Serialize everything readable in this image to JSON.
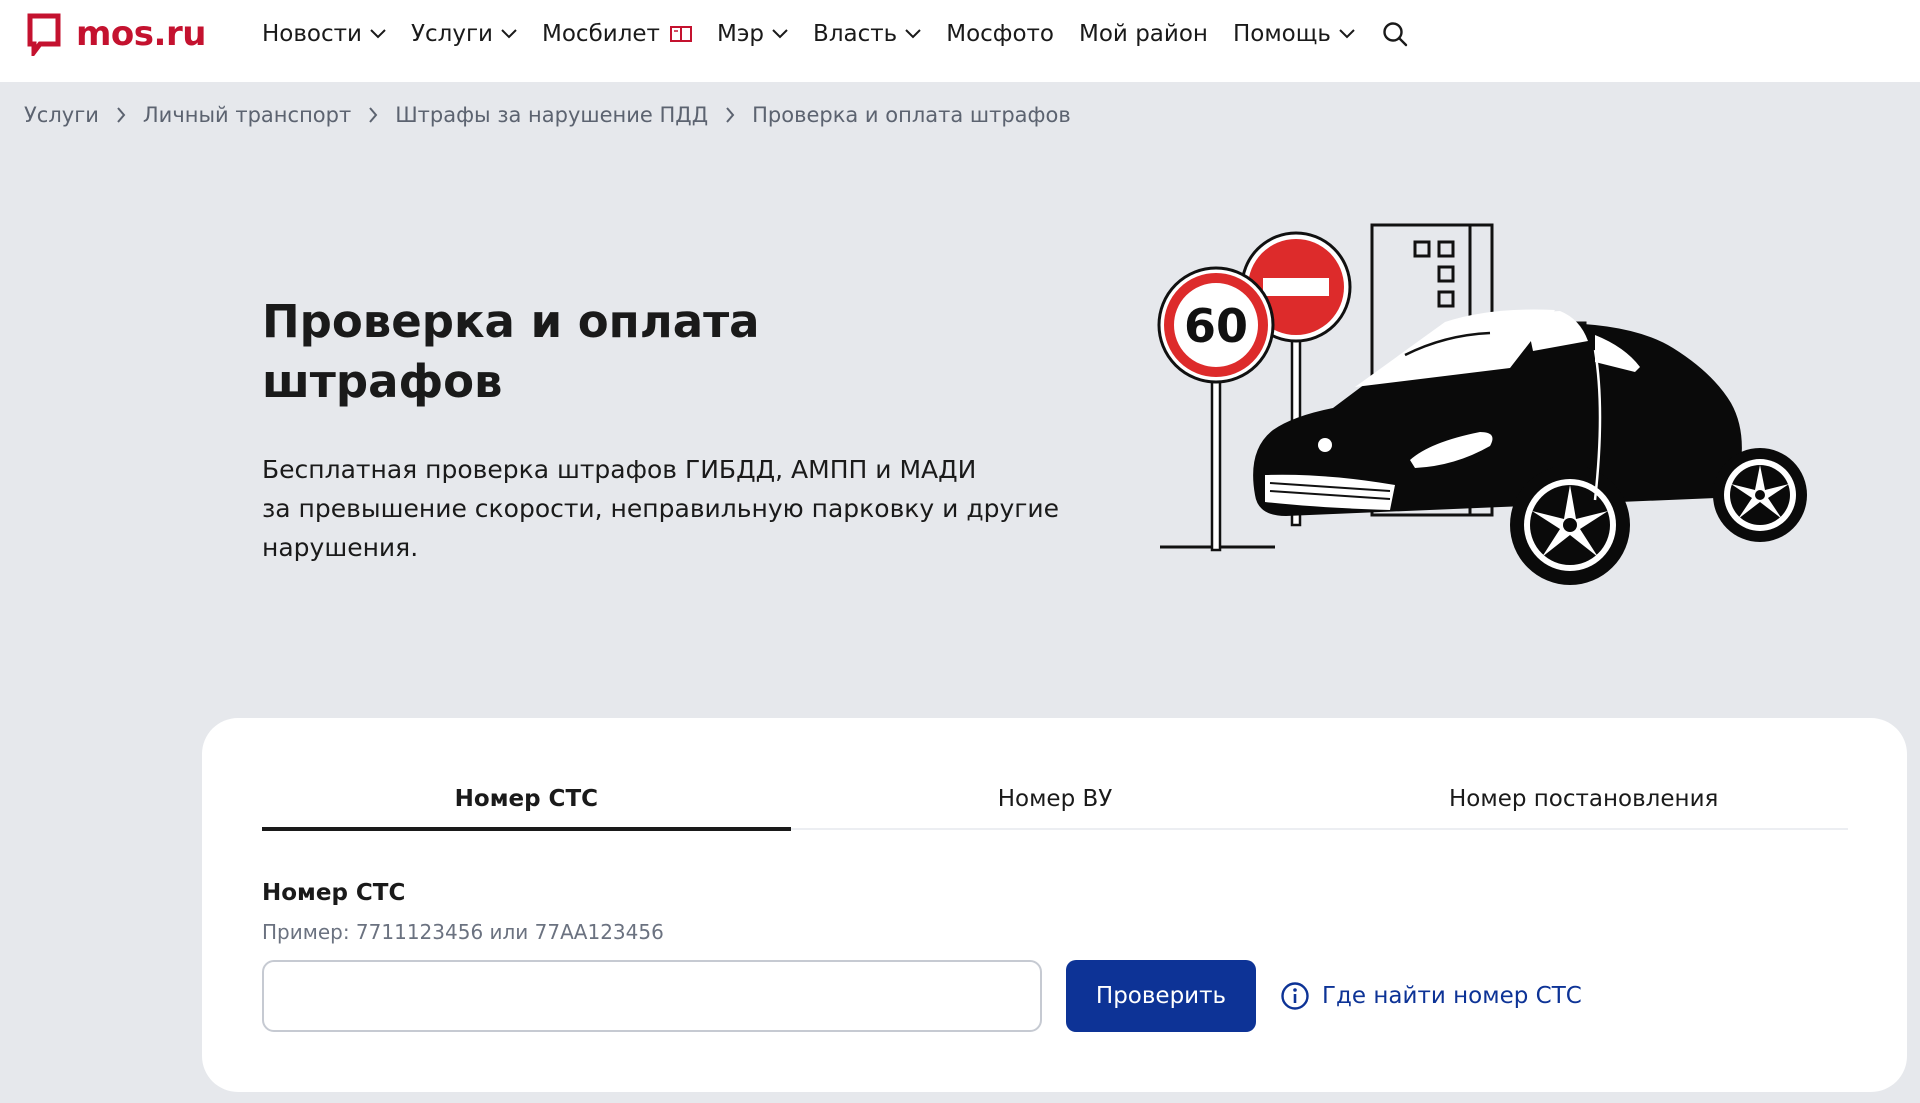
{
  "header": {
    "logo_text": "mos.ru",
    "nav": [
      {
        "label": "Новости",
        "has_dropdown": true
      },
      {
        "label": "Услуги",
        "has_dropdown": true
      },
      {
        "label": "Мосбилет",
        "has_dropdown": false,
        "icon": "ticket-icon"
      },
      {
        "label": "Мэр",
        "has_dropdown": true
      },
      {
        "label": "Власть",
        "has_dropdown": true
      },
      {
        "label": "Мосфото",
        "has_dropdown": false
      },
      {
        "label": "Мой район",
        "has_dropdown": false
      },
      {
        "label": "Помощь",
        "has_dropdown": true
      }
    ],
    "search_icon": "search-icon"
  },
  "breadcrumb": [
    "Услуги",
    "Личный транспорт",
    "Штрафы за нарушение ПДД",
    "Проверка и оплата штрафов"
  ],
  "hero": {
    "title_line1": "Проверка и оплата",
    "title_line2": "штрафов",
    "desc_line1": "Бесплатная проверка штрафов ГИБДД, АМПП и МАДИ",
    "desc_line2": "за превышение скорости, неправильную парковку и другие",
    "desc_line3": "нарушения.",
    "speed_sign_value": "60"
  },
  "form": {
    "tabs": [
      {
        "label": "Номер СТС",
        "active": true
      },
      {
        "label": "Номер ВУ",
        "active": false
      },
      {
        "label": "Номер постановления",
        "active": false
      }
    ],
    "field_label": "Номер СТС",
    "field_hint": "Пример: 7711123456 или 77АА123456",
    "input_value": "",
    "submit_label": "Проверить",
    "help_link": "Где найти номер СТС"
  },
  "colors": {
    "brand_red": "#c4122f",
    "primary_blue": "#0d3396",
    "page_bg": "#e6e8ec"
  }
}
